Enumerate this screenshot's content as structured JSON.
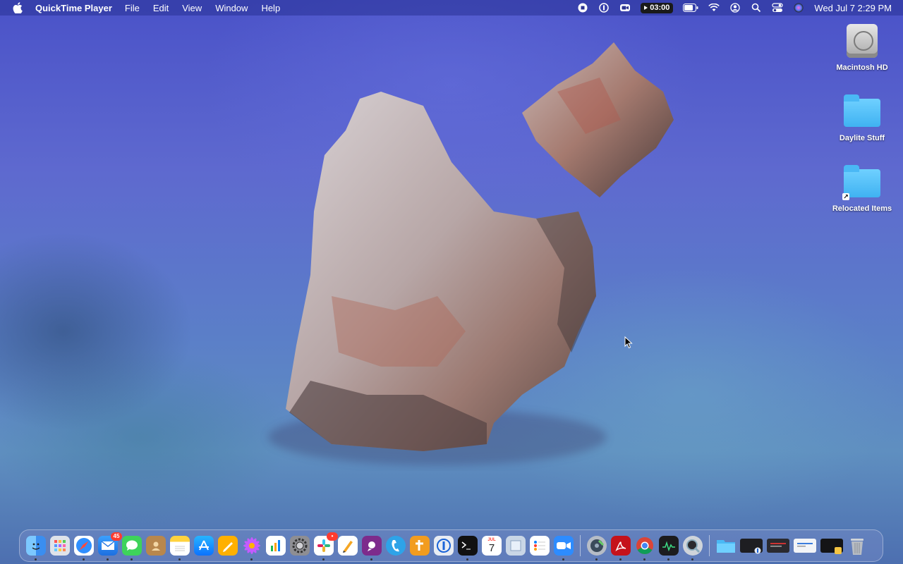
{
  "menubar": {
    "app_name": "QuickTime Player",
    "menus": [
      "File",
      "Edit",
      "View",
      "Window",
      "Help"
    ],
    "recording_timer": "03:00",
    "clock": "Wed Jul 7  2:29 PM",
    "status_icons": [
      "stop-recording-icon",
      "1password-icon",
      "zoom-video-icon",
      "timer-badge",
      "battery-icon",
      "wifi-icon",
      "user-icon",
      "search-icon",
      "control-center-icon",
      "siri-icon"
    ]
  },
  "desktop": {
    "icons": [
      {
        "label": "Macintosh HD",
        "icon": "hard-drive-icon"
      },
      {
        "label": "Daylite Stuff",
        "icon": "folder-icon"
      },
      {
        "label": "Relocated Items",
        "icon": "folder-alias-icon"
      }
    ]
  },
  "dock": {
    "mail_badge": "45",
    "slack_badge": "•",
    "calendar_month": "JUL",
    "calendar_day": "7",
    "apps": [
      "finder",
      "launchpad",
      "safari",
      "mail",
      "messages",
      "contacts",
      "notes",
      "app-store",
      "pages",
      "flower",
      "numbers",
      "system-preferences",
      "slack",
      "pencil",
      "business",
      "phone",
      "tally",
      "1password",
      "terminal",
      "calendar",
      "preview",
      "reminders",
      "zoom",
      "disk-utility",
      "acrobat",
      "chrome",
      "activity-monitor",
      "quicktime",
      "folder",
      "window-1",
      "window-2",
      "window-3",
      "window-4",
      "trash"
    ]
  }
}
